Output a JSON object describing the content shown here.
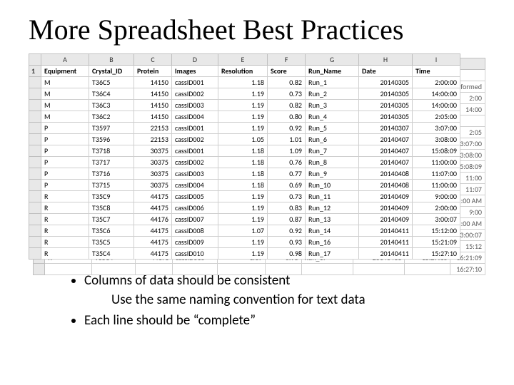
{
  "title": "More Spreadsheet Best Practices",
  "sheet": {
    "col_letters": [
      "A",
      "B",
      "C",
      "D",
      "E",
      "F",
      "G",
      "H",
      "I"
    ],
    "headers": [
      "Equipment",
      "Crystal_ID",
      "Protein",
      "Images",
      "Resolution",
      "Score",
      "Run_Name",
      "Date",
      "Time"
    ],
    "rows": [
      {
        "cells": [
          "M",
          "T36C5",
          "14150",
          "cassID001",
          "1.18",
          "0.82",
          "Run_1",
          "20140305",
          "2:00:00"
        ],
        "ghost_tail": "formed"
      },
      {
        "cells": [
          "M",
          "T36C4",
          "14150",
          "cassID002",
          "1.19",
          "0.73",
          "Run_2",
          "20140305",
          "14:00:00"
        ],
        "ghost_tail": "2:00"
      },
      {
        "cells": [
          "M",
          "T36C3",
          "14150",
          "cassID003",
          "1.19",
          "0.82",
          "Run_3",
          "20140305",
          "14:00:00"
        ],
        "ghost_tail": "14:00"
      },
      {
        "cells": [
          "M",
          "T36C2",
          "14150",
          "cassID004",
          "1.19",
          "0.80",
          "Run_4",
          "20140305",
          "2:05:00"
        ],
        "ghost_tail": ""
      },
      {
        "cells": [
          "P",
          "T3597",
          "22153",
          "cassID001",
          "1.19",
          "0.92",
          "Run_5",
          "20140307",
          "3:07:00"
        ],
        "ghost_tail": "2:05"
      },
      {
        "cells": [
          "P",
          "T3596",
          "22153",
          "cassID002",
          "1.05",
          "1.01",
          "Run_6",
          "20140407",
          "3:08:00"
        ],
        "ghost_tail": "3:07:00"
      },
      {
        "cells": [
          "P",
          "T3718",
          "30375",
          "cassID001",
          "1.18",
          "1.09",
          "Run_7",
          "20140407",
          "15:08:09"
        ],
        "ghost_tail": "3:08:00"
      },
      {
        "cells": [
          "P",
          "T3717",
          "30375",
          "cassID002",
          "1.18",
          "0.76",
          "Run_8",
          "20140407",
          "11:00:00"
        ],
        "ghost_tail": "15:08:09"
      },
      {
        "cells": [
          "P",
          "T3716",
          "30375",
          "cassID003",
          "1.18",
          "0.77",
          "Run_9",
          "20140408",
          "11:07:00"
        ],
        "ghost_tail": "11:00"
      },
      {
        "cells": [
          "P",
          "T3715",
          "30375",
          "cassID004",
          "1.18",
          "0.69",
          "Run_10",
          "20140408",
          "11:00:00"
        ],
        "ghost_tail": "11:07"
      },
      {
        "cells": [
          "R",
          "T35C9",
          "44175",
          "cassID005",
          "1.19",
          "0.73",
          "Run_11",
          "20140409",
          "9:00:00"
        ],
        "ghost_tail": "1:00 AM"
      },
      {
        "cells": [
          "R",
          "T35C8",
          "44175",
          "cassID006",
          "1.19",
          "0.83",
          "Run_12",
          "20140409",
          "2:00:00"
        ],
        "ghost_tail": "9:00"
      },
      {
        "cells": [
          "R",
          "T35C7",
          "44176",
          "cassID007",
          "1.19",
          "0.87",
          "Run_13",
          "20140409",
          "3:00:07"
        ],
        "ghost_tail": "2:00 AM"
      },
      {
        "cells": [
          "R",
          "T35C6",
          "44175",
          "cassID008",
          "1.07",
          "0.92",
          "Run_14",
          "20140411",
          "15:12:00"
        ],
        "ghost_tail": "3:00:07"
      },
      {
        "cells": [
          "R",
          "T35C5",
          "44175",
          "cassID009",
          "1.19",
          "0.93",
          "Run_16",
          "20140411",
          "15:21:09"
        ],
        "ghost_tail": "15:12"
      },
      {
        "cells": [
          "R",
          "T35C4",
          "44175",
          "cassID010",
          "1.19",
          "0.98",
          "Run_17",
          "20140411",
          "15:27:10"
        ],
        "ghost_tail": "16:21:09"
      }
    ],
    "ghost_last_tail": "16:27:10"
  },
  "bullets": {
    "b1": "Columns of data should be consistent",
    "b1_sub": "Use the same naming convention for text data",
    "b2": "Each line should be “complete”"
  }
}
